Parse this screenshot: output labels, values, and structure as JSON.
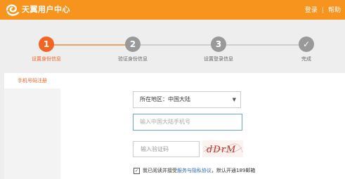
{
  "header": {
    "brand": "天翼用户中心",
    "login": "登录",
    "separator": "|",
    "help": "帮助"
  },
  "steps": [
    {
      "number": "1",
      "label": "设置身份信息",
      "state": "active"
    },
    {
      "number": "2",
      "label": "验证身份信息",
      "state": "pending"
    },
    {
      "number": "3",
      "label": "设置登录信息",
      "state": "pending"
    },
    {
      "number": "✓",
      "label": "完成",
      "state": "pending"
    }
  ],
  "sidebar": {
    "tab_label": "手机号码注册"
  },
  "form": {
    "region_value": "所在地区：中国大陆",
    "phone_placeholder": "输入中国大陆手机号",
    "captcha_placeholder": "输入验证码",
    "captcha_text": "dDrM",
    "agree_prefix": "我已阅读并接受",
    "agree_link": "服务与隐私协议",
    "agree_suffix": "，默认开通189邮箱"
  },
  "colors": {
    "brand_orange": "#f7941d",
    "active_step": "#f26522",
    "inactive_step": "#999999",
    "link": "#2b6cb3"
  }
}
